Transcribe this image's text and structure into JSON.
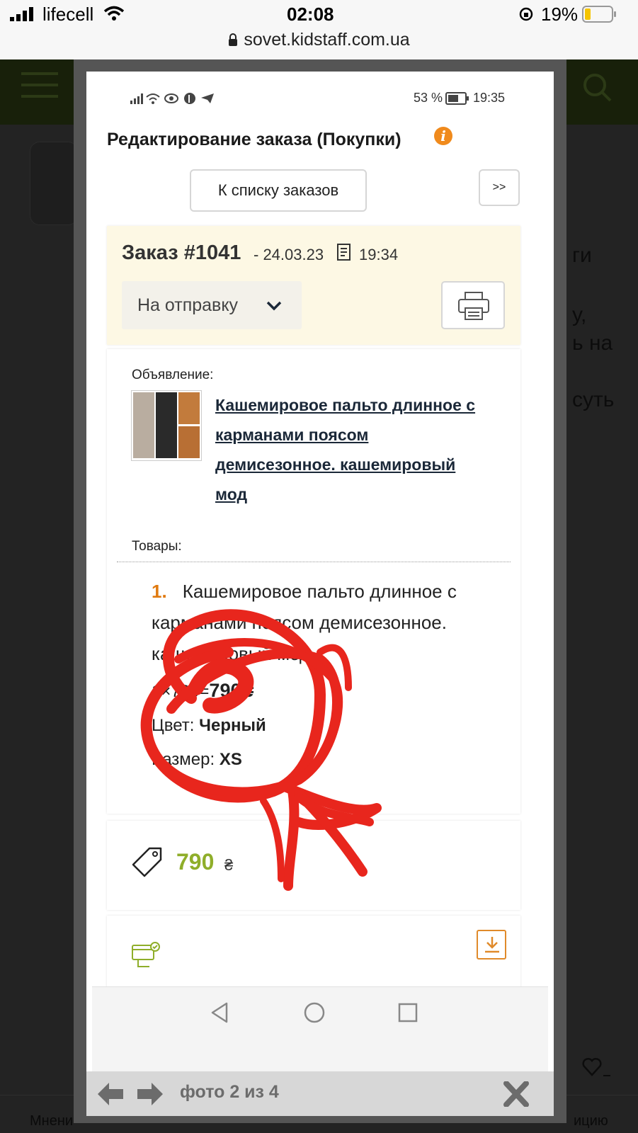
{
  "ios_status": {
    "carrier": "lifecell",
    "time": "02:08",
    "battery": "19%"
  },
  "browser": {
    "url": "sovet.kidstaff.com.ua"
  },
  "background_site": {
    "text_fragments": [
      "ги",
      "у,",
      "ь на",
      "суть"
    ],
    "bottom_left": "Мнени",
    "bottom_right": "ицию"
  },
  "inner_phone": {
    "battery": "53 %",
    "time": "19:35"
  },
  "page": {
    "title": "Редактирование заказа (Покупки)",
    "info_icon": "i",
    "back_button": "К списку заказов",
    "next_button": ">>"
  },
  "order": {
    "number": "Заказ #1041",
    "date": "- 24.03.23",
    "time": "19:34",
    "status": "На отправку"
  },
  "listing": {
    "label": "Объявление:",
    "link_lines": [
      "Кашемировое пальто длинное с",
      "карманами поясом",
      "демисезонное. кашемировый",
      "мод"
    ]
  },
  "goods": {
    "label": "Товары:",
    "items": [
      {
        "index": "1.",
        "name_lines": [
          "Кашемировое пальто длинное с",
          "карманами поясом демисезонное.",
          "кашемировый мод"
        ],
        "price_line_prefix": "1×790=",
        "price_line_total": "790₴",
        "color_label": "Цвет:",
        "color_value": "Черный",
        "size_label": "Размер:",
        "size_value": "XS"
      }
    ]
  },
  "total": {
    "amount": "790",
    "currency": "₴"
  },
  "gallery": {
    "caption": "фото 2 из 4"
  },
  "colors": {
    "accent_green": "#8fae2a",
    "order_bg": "#fdf8e4",
    "info_orange": "#f08a1c",
    "annotation_red": "#e8261d"
  }
}
